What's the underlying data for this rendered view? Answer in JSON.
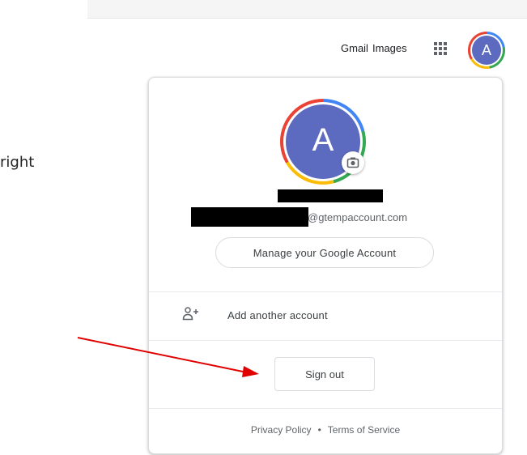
{
  "instruction_fragment": "right",
  "google_bar": {
    "gmail_label": "Gmail",
    "images_label": "Images",
    "apps_icon": "apps-grid-icon",
    "avatar_letter": "A"
  },
  "account_menu": {
    "avatar_letter": "A",
    "camera_icon": "camera-icon",
    "email_suffix": "@gtempaccount.com",
    "manage_label": "Manage your Google Account",
    "add_account_icon": "add-person-icon",
    "add_account_label": "Add another account",
    "sign_out_label": "Sign out",
    "footer": {
      "privacy_label": "Privacy Policy",
      "separator": "•",
      "terms_label": "Terms of Service"
    }
  },
  "annotation": {
    "arrow_color": "#e00000"
  },
  "colors": {
    "avatar_fill": "#5c6bc0",
    "ring_blue": "#4285f4",
    "ring_green": "#34a853",
    "ring_yellow": "#fbbc05",
    "ring_red": "#ea4335"
  }
}
